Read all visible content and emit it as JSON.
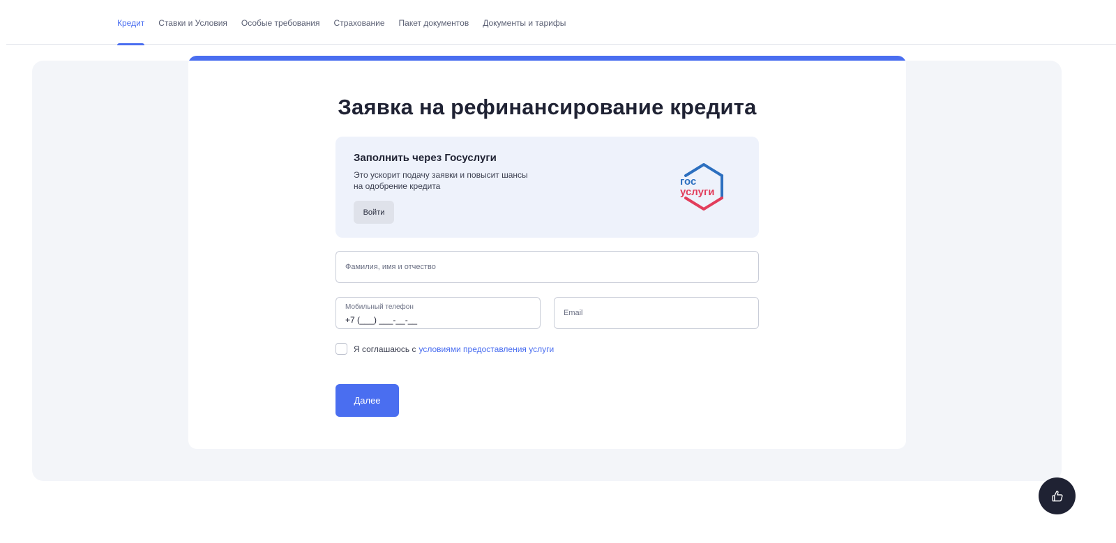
{
  "nav": {
    "tabs": [
      {
        "label": "Кредит",
        "active": true
      },
      {
        "label": "Ставки и Условия"
      },
      {
        "label": "Особые требования"
      },
      {
        "label": "Страхование"
      },
      {
        "label": "Пакет документов"
      },
      {
        "label": "Документы и тарифы"
      }
    ]
  },
  "form": {
    "title": "Заявка на рефинансирование кредита",
    "gosuslugi": {
      "title": "Заполнить через Госуслуги",
      "description": "Это ускорит подачу заявки и повысит шансы на одобрение кредита",
      "login_label": "Войти",
      "logo_text_top": "гос",
      "logo_text_bottom": "услуги"
    },
    "fio": {
      "placeholder": "Фамилия, имя и отчество"
    },
    "phone": {
      "label": "Мобильный телефон",
      "placeholder": "+7 (___) ___-__-__"
    },
    "email": {
      "placeholder": "Email"
    },
    "consent": {
      "text": "Я соглашаюсь с",
      "link": "условиями предоставления услуги"
    },
    "next_label": "Далее"
  },
  "colors": {
    "accent": "#4a6ef0",
    "gos_blue": "#2c6fbf",
    "gos_red": "#e23d5b",
    "fab_bg": "#1f2233"
  },
  "fab": {
    "icon": "thumbs-up-icon"
  }
}
